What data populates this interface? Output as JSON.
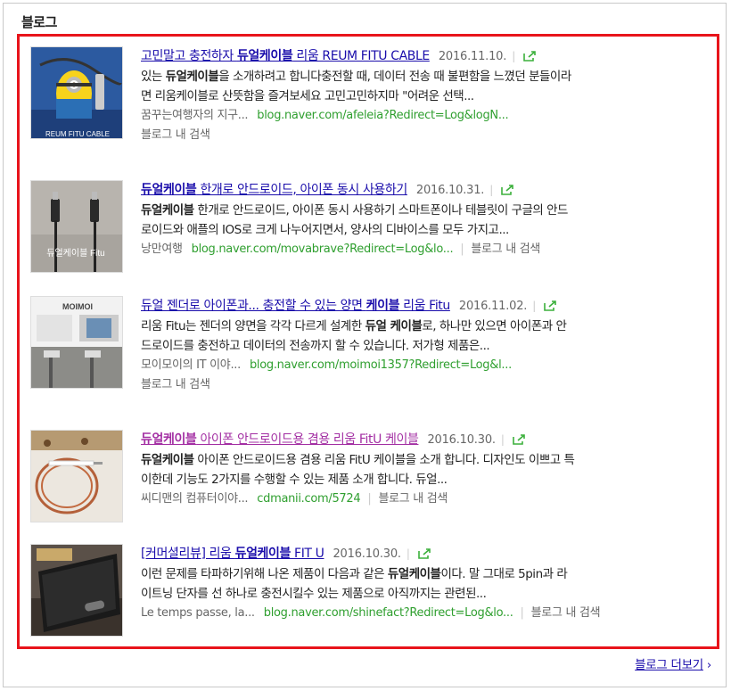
{
  "section_title": "블로그",
  "more_label": "블로그 더보기",
  "more_chevron": "›",
  "search_in_blog": "블로그 내 검색",
  "items": [
    {
      "thumb_caption": "REUM FITU CABLE",
      "title_pre": "고민말고 충전하자 ",
      "title_hl": "듀얼케이블",
      "title_post": " 리움 REUM FITU CABLE",
      "date": "2016.11.10.",
      "desc_1a": "있는 ",
      "desc_1b": "듀얼케이블",
      "desc_1c": "을 소개하려고 합니다충전할 때, 데이터 전송 때 불편함을 느꼈던 분들이라",
      "desc_2": "면 리움케이블로 산뜻함을 즐겨보세요 고민고민하지마 \"어려운 선택...",
      "author": "꿈꾸는여행자의 지구...",
      "url": "blog.naver.com/afeleia?Redirect=Log&logN..."
    },
    {
      "thumb_caption": "듀얼케이블 Fitu",
      "title_pre": "",
      "title_hl": "듀얼케이블",
      "title_post": " 한개로 안드로이드, 아이폰 동시 사용하기",
      "date": "2016.10.31.",
      "desc_1a": "",
      "desc_1b": "듀얼케이블",
      "desc_1c": " 한개로 안드로이드, 아이폰 동시 사용하기 스마트폰이나 테블릿이 구글의 안드",
      "desc_2": "로이드와 애플의 IOS로 크게 나누어지면서, 양사의 디바이스를 모두 가지고...",
      "author": "낭만여행",
      "url": "blog.naver.com/movabrave?Redirect=Log&lo..."
    },
    {
      "thumb_caption": "MOIMOI",
      "title_pre": "듀얼 젠더로 아이폰과... 충전할 수 있는 양면 ",
      "title_hl": "케이블",
      "title_post": " 리움 Fitu",
      "date": "2016.11.02.",
      "desc_1a": "리움 Fitu는 젠더의 양면을 각각 다르게 설계한 ",
      "desc_1b": "듀얼 케이블",
      "desc_1c": "로, 하나만 있으면 아이폰과 안",
      "desc_2": "드로이드를 충전하고 데이터의 전송까지 할 수 있습니다. 저가형 제품은...",
      "author": "모이모이의 IT 이야...",
      "url": "blog.naver.com/moimoi1357?Redirect=Log&l..."
    },
    {
      "thumb_caption": "",
      "title_pre": "",
      "title_hl": "듀얼케이블",
      "title_post": " 아이폰 안드로이드용 겸용 리움 FitU 케이블",
      "date": "2016.10.30.",
      "desc_1a": "",
      "desc_1b": "듀얼케이블",
      "desc_1c": " 아이폰 안드로이드용 겸용 리움 FitU 케이블을 소개 합니다. 디자인도 이쁘고 특",
      "desc_2": "이한데 기능도 2가지를 수행할 수 있는 제품 소개 합니다. 듀얼...",
      "author": "씨디맨의 컴퓨터이야...",
      "url": "cdmanii.com/5724"
    },
    {
      "thumb_caption": "",
      "title_pre": "[커머셜리뷰] 리움 ",
      "title_hl": "듀얼케이블",
      "title_post": " FIT U",
      "date": "2016.10.30.",
      "desc_1a": "이런 문제를 타파하기위해 나온 제품이 다음과 같은 ",
      "desc_1b": "듀얼케이블",
      "desc_1c": "이다. 말 그대로 5pin과 라",
      "desc_2": "이트닝 단자를 선 하나로 충전시킬수 있는 제품으로 아직까지는 관련된...",
      "author": "Le temps passe, la...",
      "url": "blog.naver.com/shinefact?Redirect=Log&lo..."
    }
  ]
}
